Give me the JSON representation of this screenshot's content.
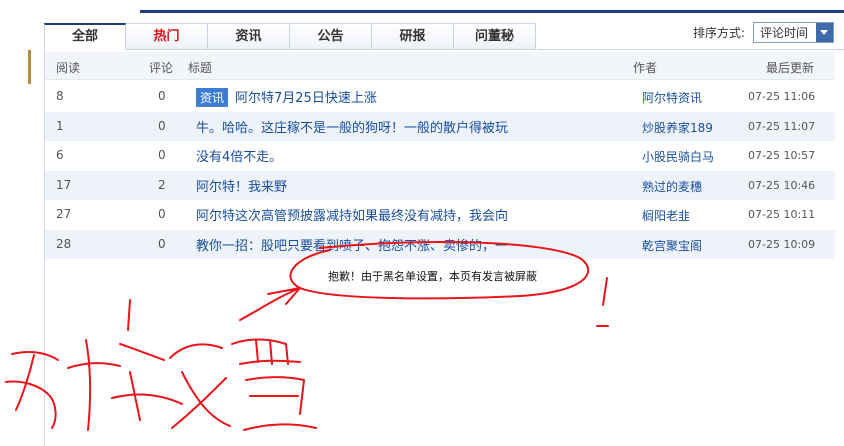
{
  "tabs": [
    {
      "label": "全部"
    },
    {
      "label": "热门"
    },
    {
      "label": "资讯"
    },
    {
      "label": "公告"
    },
    {
      "label": "研报"
    },
    {
      "label": "问董秘"
    }
  ],
  "sort": {
    "label": "排序方式:",
    "value": "评论时间"
  },
  "columns": {
    "read": "阅读",
    "comment": "评论",
    "title": "标题",
    "author": "作者",
    "updated": "最后更新"
  },
  "rows": [
    {
      "read": "8",
      "comment": "0",
      "tag": "资讯",
      "title": "阿尔特7月25日快速上涨",
      "author": "阿尔特资讯",
      "time": "07-25 11:06"
    },
    {
      "read": "1",
      "comment": "0",
      "tag": "",
      "title": "牛。哈哈。这庄稼不是一般的狗呀！一般的散户得被玩",
      "author": "炒股养家189",
      "time": "07-25 11:07"
    },
    {
      "read": "6",
      "comment": "0",
      "tag": "",
      "title": "没有4倍不走。",
      "author": "小股民骑白马",
      "time": "07-25 10:57"
    },
    {
      "read": "17",
      "comment": "2",
      "tag": "",
      "title": "阿尔特！我来野",
      "author": "熟过的麦穗",
      "time": "07-25 10:46"
    },
    {
      "read": "27",
      "comment": "0",
      "tag": "",
      "title": "阿尔特这次高管预披露减持如果最终没有减持，我会向",
      "author": "榈阳老韭",
      "time": "07-25 10:11"
    },
    {
      "read": "28",
      "comment": "0",
      "tag": "",
      "title": "教你一招：股吧只要看到喷子、抱怨不涨、卖惨的，一",
      "author": "乾宫聚宝阁",
      "time": "07-25 10:09"
    }
  ],
  "notice": "抱歉！由于黑名单设置，本页有发言被屏蔽",
  "colors": {
    "accent": "#1a3e80",
    "hot": "#d4161c",
    "link": "#1a4ea0",
    "annotation": "#e8151b"
  }
}
